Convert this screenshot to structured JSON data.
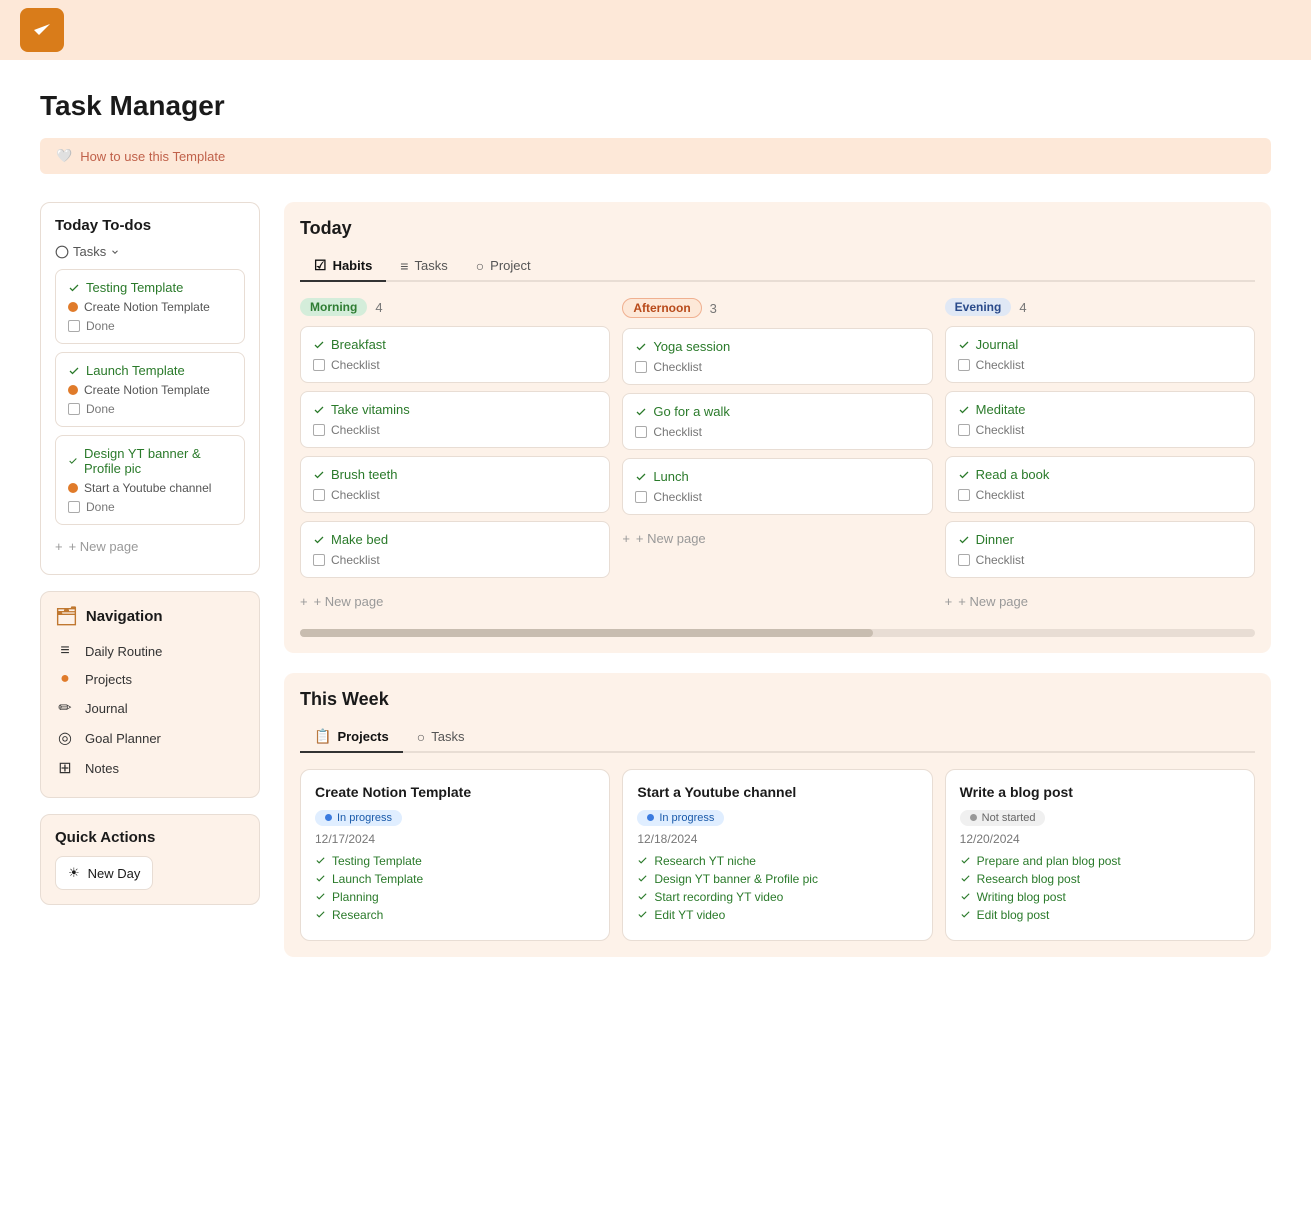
{
  "topbar": {
    "logo_alt": "Task Manager Logo"
  },
  "page": {
    "title": "Task Manager",
    "template_banner": "How to use this Template"
  },
  "left": {
    "today_todos_title": "Today To-dos",
    "tasks_label": "Tasks",
    "task_cards": [
      {
        "title": "Testing  Template",
        "sub": "Create Notion Template",
        "done": "Done"
      },
      {
        "title": "Launch Template",
        "sub": "Create Notion Template",
        "done": "Done"
      },
      {
        "title": "Design YT banner & Profile pic",
        "sub": "Start a Youtube channel",
        "done": "Done"
      }
    ],
    "new_page_label": "+ New page",
    "navigation_title": "Navigation",
    "nav_items": [
      {
        "icon": "≡",
        "label": "Daily Routine"
      },
      {
        "icon": "●",
        "label": "Projects"
      },
      {
        "icon": "✏",
        "label": "Journal"
      },
      {
        "icon": "◎",
        "label": "Goal Planner"
      },
      {
        "icon": "⊞",
        "label": "Notes"
      }
    ],
    "quick_actions_title": "Quick Actions",
    "new_day_label": "New Day"
  },
  "today": {
    "section_title": "Today",
    "tabs": [
      {
        "label": "Habits",
        "icon": "☑",
        "active": true
      },
      {
        "label": "Tasks",
        "icon": "≡",
        "active": false
      },
      {
        "label": "Project",
        "icon": "○",
        "active": false
      }
    ],
    "columns": [
      {
        "tag": "Morning",
        "tag_class": "tag-morning",
        "count": "4",
        "items": [
          {
            "title": "Breakfast",
            "checklist": "Checklist"
          },
          {
            "title": "Take vitamins",
            "checklist": "Checklist"
          },
          {
            "title": "Brush teeth",
            "checklist": "Checklist"
          },
          {
            "title": "Make bed",
            "checklist": "Checklist"
          }
        ]
      },
      {
        "tag": "Afternoon",
        "tag_class": "tag-afternoon",
        "count": "3",
        "items": [
          {
            "title": "Yoga session",
            "checklist": "Checklist"
          },
          {
            "title": "Go for a walk",
            "checklist": "Checklist"
          },
          {
            "title": "Lunch",
            "checklist": "Checklist"
          }
        ]
      },
      {
        "tag": "Evening",
        "tag_class": "tag-evening",
        "count": "4",
        "items": [
          {
            "title": "Journal",
            "checklist": "Checklist"
          },
          {
            "title": "Meditate",
            "checklist": "Checklist"
          },
          {
            "title": "Read a book",
            "checklist": "Checklist"
          },
          {
            "title": "Dinner",
            "checklist": "Checklist"
          }
        ]
      }
    ],
    "new_page_label": "+ New page"
  },
  "this_week": {
    "section_title": "This Week",
    "tabs": [
      {
        "label": "Projects",
        "icon": "📋",
        "active": true
      },
      {
        "label": "Tasks",
        "icon": "○",
        "active": false
      }
    ],
    "projects": [
      {
        "title": "Create Notion Template",
        "status": "In progress",
        "status_class": "badge-inprogress",
        "dot_class": "badge-dot-blue",
        "date": "12/17/2024",
        "tasks": [
          "Testing Template",
          "Launch Template",
          "Planning",
          "Research"
        ]
      },
      {
        "title": "Start a Youtube channel",
        "status": "In progress",
        "status_class": "badge-inprogress",
        "dot_class": "badge-dot-blue",
        "date": "12/18/2024",
        "tasks": [
          "Research YT niche",
          "Design YT banner & Profile pic",
          "Start recording YT video",
          "Edit YT video"
        ]
      },
      {
        "title": "Write a blog post",
        "status": "Not started",
        "status_class": "badge-notstarted",
        "dot_class": "badge-dot-gray",
        "date": "12/20/2024",
        "tasks": [
          "Prepare and plan blog post",
          "Research blog post",
          "Writing blog post",
          "Edit blog post"
        ]
      }
    ]
  }
}
